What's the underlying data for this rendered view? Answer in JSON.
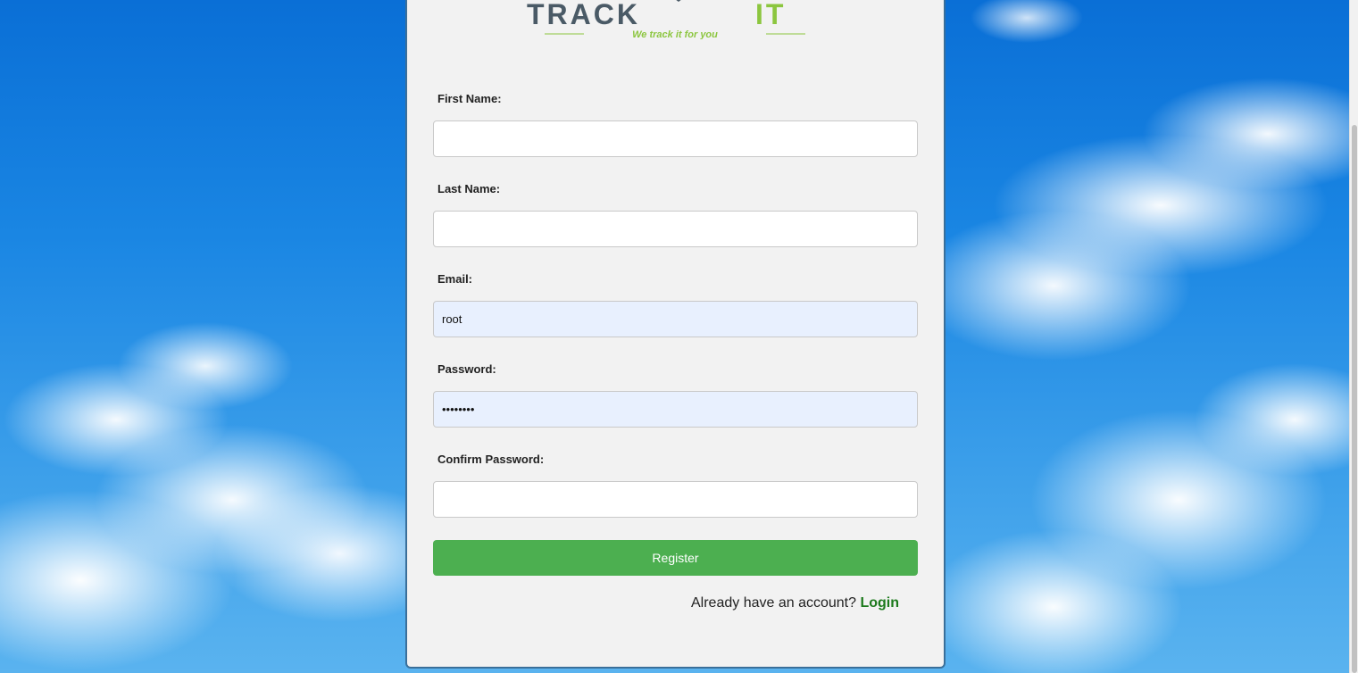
{
  "brand": {
    "name_part1": "TRACK",
    "name_part2": "IT",
    "tagline": "We track it for you",
    "colors": {
      "dark": "#4a5a66",
      "accent": "#8cc63f"
    }
  },
  "form": {
    "first_name": {
      "label": "First Name:",
      "value": ""
    },
    "last_name": {
      "label": "Last Name:",
      "value": ""
    },
    "email": {
      "label": "Email:",
      "value": "root"
    },
    "password": {
      "label": "Password:",
      "value": "••••••••"
    },
    "confirm_password": {
      "label": "Confirm Password:",
      "value": ""
    },
    "register_label": "Register"
  },
  "footer": {
    "prompt": "Already have an account?",
    "login_label": "Login"
  },
  "colors": {
    "register_button": "#4caf50",
    "login_link": "#1d7a1d",
    "card_border": "#3a6f9a",
    "autofill_background": "#e8f0fe"
  }
}
